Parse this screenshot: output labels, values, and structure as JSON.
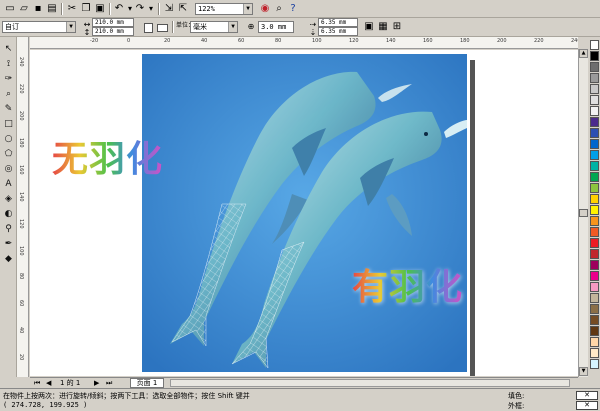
{
  "toolbar": {
    "zoom_value": "122%",
    "icons": [
      "new-icon",
      "open-icon",
      "save-icon",
      "print-icon",
      "cut-icon",
      "copy-icon",
      "paste-icon",
      "undo-icon",
      "redo-icon",
      "import-icon",
      "export-icon",
      "zoom-icon",
      "app-launcher-icon",
      "help-icon"
    ]
  },
  "propbar": {
    "paper_type": "自订",
    "width": "210.0 mm",
    "height": "210.0 mm",
    "units_label": "单位：",
    "units": "毫米",
    "nudge": "3.0 mm",
    "dup_x": "6.35 mm",
    "dup_y": "6.35 mm"
  },
  "ruler": {
    "top_labels": [
      "-20",
      "0",
      "20",
      "40",
      "60",
      "80",
      "100",
      "120",
      "140",
      "160",
      "180",
      "200",
      "220",
      "240"
    ],
    "left_labels": [
      "240",
      "220",
      "200",
      "180",
      "160",
      "140",
      "120",
      "100",
      "80",
      "60",
      "40",
      "20"
    ]
  },
  "canvas": {
    "wordart_no_feather": "无羽化",
    "wordart_feather": "有羽化"
  },
  "page_tabs": {
    "count": "1 的 1",
    "page1": "页面 1"
  },
  "status": {
    "hint": "在物件上按两次：进行旋转/倾斜；按两下工具：选取全部物件；按住 Shift 键并",
    "coords": "( 274.728, 199.925 )",
    "fill_label": "填色:",
    "outline_label": "外框:",
    "fill_x": "✕",
    "outline_x": "✕"
  },
  "palette": [
    "#ffffff",
    "#000000",
    "#6e6e6e",
    "#9a9a9a",
    "#c8c8c8",
    "#e0e0e0",
    "#f2f2f2",
    "#4a2a8c",
    "#2d4fb3",
    "#0066cc",
    "#00a0e8",
    "#00b3a4",
    "#00a651",
    "#8cc63f",
    "#ffd200",
    "#fff200",
    "#f7941d",
    "#f15a24",
    "#ed1c24",
    "#c1272d",
    "#9e005d",
    "#ec008c",
    "#f49ac1",
    "#c2b59b",
    "#8b6f47",
    "#754c24",
    "#603813",
    "#ffd7a8",
    "#ffe9c7",
    "#d7f5ff"
  ],
  "colors": {
    "artwork_bg": "#3a8ad4",
    "wordart_gradient": [
      "#e64545",
      "#ebc933",
      "#4ec14a",
      "#3f8be0",
      "#d44fc5"
    ]
  }
}
